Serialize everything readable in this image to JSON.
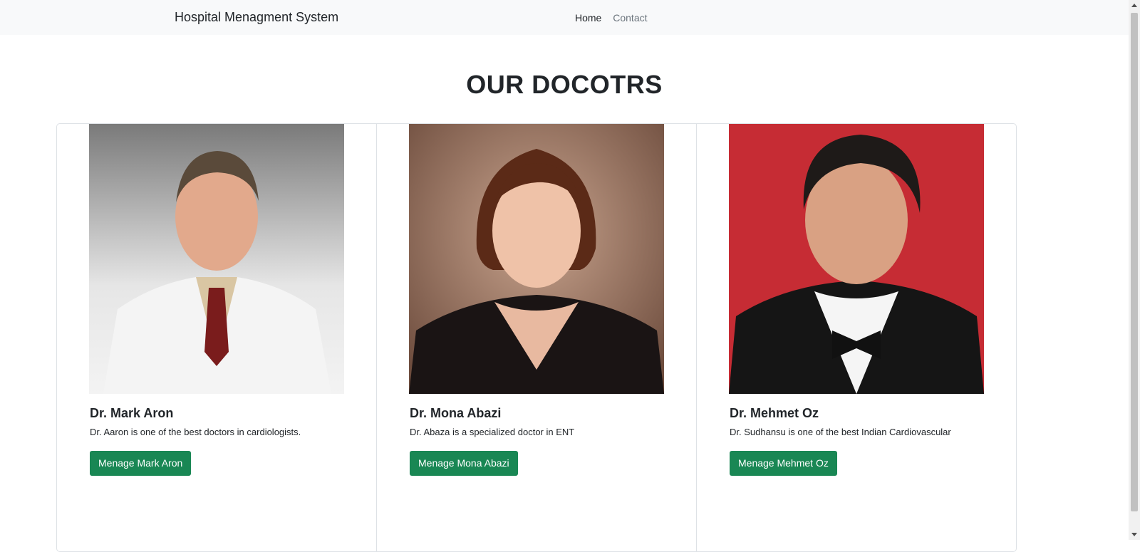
{
  "navbar": {
    "brand": "Hospital Menagment System",
    "links": [
      {
        "label": "Home",
        "active": true
      },
      {
        "label": "Contact",
        "active": false
      }
    ]
  },
  "page": {
    "title": "OUR DOCOTRS"
  },
  "doctors": [
    {
      "name": "Dr. Mark Aron",
      "description": "Dr. Aaron is one of the best doctors in cardiologists.",
      "button": "Menage Mark Aron"
    },
    {
      "name": "Dr. Mona Abazi",
      "description": "Dr. Abaza is a specialized doctor in ENT",
      "button": "Menage Mona Abazi"
    },
    {
      "name": "Dr. Mehmet Oz",
      "description": "Dr. Sudhansu is one of the best Indian Cardiovascular",
      "button": "Menage Mehmet Oz"
    }
  ],
  "colors": {
    "navbar_bg": "#f8f9fa",
    "button_green": "#198754"
  }
}
